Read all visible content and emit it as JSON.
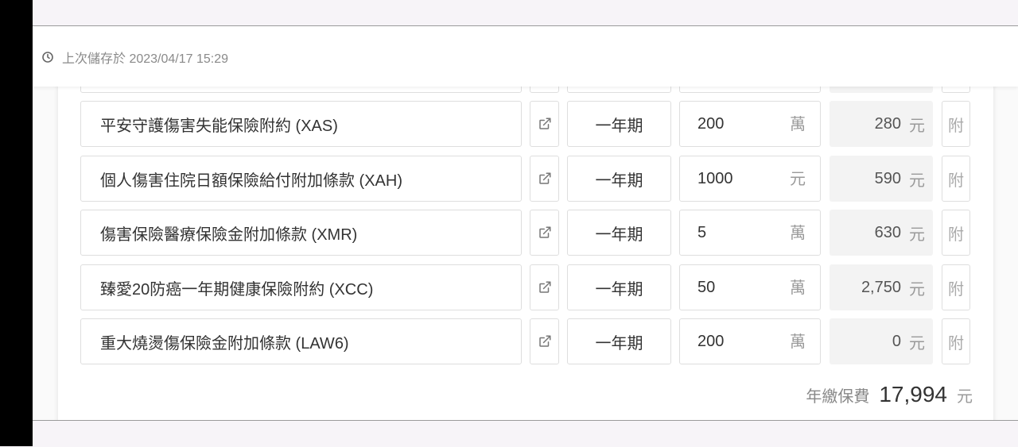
{
  "save_status": {
    "text": "上次儲存於 2023/04/17 15:29"
  },
  "riders": [
    {
      "name": "平安守護傷害失能保險附約 (XAS)",
      "term": "一年期",
      "amount": "200",
      "amount_unit": "萬",
      "premium": "280",
      "premium_unit": "元",
      "rider_label": "附"
    },
    {
      "name": "個人傷害住院日額保險給付附加條款 (XAH)",
      "term": "一年期",
      "amount": "1000",
      "amount_unit": "元",
      "premium": "590",
      "premium_unit": "元",
      "rider_label": "附"
    },
    {
      "name": "傷害保險醫療保險金附加條款 (XMR)",
      "term": "一年期",
      "amount": "5",
      "amount_unit": "萬",
      "premium": "630",
      "premium_unit": "元",
      "rider_label": "附"
    },
    {
      "name": "臻愛20防癌一年期健康保險附約 (XCC)",
      "term": "一年期",
      "amount": "50",
      "amount_unit": "萬",
      "premium": "2,750",
      "premium_unit": "元",
      "rider_label": "附"
    },
    {
      "name": "重大燒燙傷保險金附加條款 (LAW6)",
      "term": "一年期",
      "amount": "200",
      "amount_unit": "萬",
      "premium": "0",
      "premium_unit": "元",
      "rider_label": "附"
    }
  ],
  "total": {
    "label": "年繳保費",
    "value": "17,994",
    "unit": "元"
  },
  "icons": {
    "clock": "clock-icon",
    "external_link": "external-link-icon"
  }
}
